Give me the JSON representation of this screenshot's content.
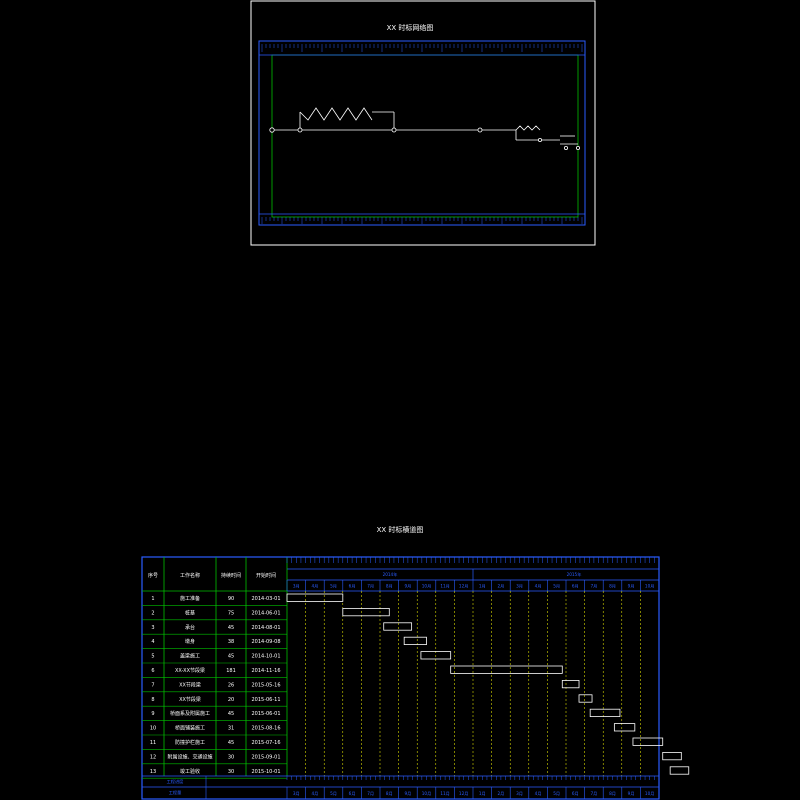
{
  "sheet1": {
    "title": "XX 时标网络图"
  },
  "sheet2": {
    "title": "XX 时标横道图",
    "headers": {
      "no": "序号",
      "task": "工作名称",
      "duration": "持续时间",
      "start": "开始时间"
    },
    "year_labels": [
      "2014年",
      "2015年"
    ],
    "months": [
      "3月",
      "4月",
      "5月",
      "6月",
      "7月",
      "8月",
      "9月",
      "10月",
      "11月",
      "12月",
      "1月",
      "2月",
      "3月",
      "4月",
      "5月",
      "6月",
      "7月",
      "8月",
      "9月",
      "10月"
    ],
    "footer": {
      "row1": "工程进度",
      "row2": "工程量"
    },
    "tasks": [
      {
        "no": "1",
        "name": "施工准备",
        "duration": "90",
        "start": "2014-03-01",
        "bar_start_month": 0,
        "bar_months": 3
      },
      {
        "no": "2",
        "name": "桩基",
        "duration": "75",
        "start": "2014-06-01",
        "bar_start_month": 3,
        "bar_months": 2.5
      },
      {
        "no": "3",
        "name": "承台",
        "duration": "45",
        "start": "2014-08-01",
        "bar_start_month": 5.2,
        "bar_months": 1.5
      },
      {
        "no": "4",
        "name": "墩身",
        "duration": "38",
        "start": "2014-09-08",
        "bar_start_month": 6.3,
        "bar_months": 1.2
      },
      {
        "no": "5",
        "name": "盖梁施工",
        "duration": "45",
        "start": "2014-10-01",
        "bar_start_month": 7.2,
        "bar_months": 1.6
      },
      {
        "no": "6",
        "name": "XX-XX节段梁",
        "duration": "181",
        "start": "2014-11-16",
        "bar_start_month": 8.8,
        "bar_months": 6
      },
      {
        "no": "7",
        "name": "XX节段梁",
        "duration": "26",
        "start": "2015-05-16",
        "bar_start_month": 14.8,
        "bar_months": 0.9
      },
      {
        "no": "8",
        "name": "XX节段梁",
        "duration": "20",
        "start": "2015-06-11",
        "bar_start_month": 15.7,
        "bar_months": 0.7
      },
      {
        "no": "9",
        "name": "桥面系及附属施工",
        "duration": "45",
        "start": "2015-06-01",
        "bar_start_month": 16.3,
        "bar_months": 1.6
      },
      {
        "no": "10",
        "name": "桥面铺装施工",
        "duration": "31",
        "start": "2015-08-16",
        "bar_start_month": 17.6,
        "bar_months": 1.1
      },
      {
        "no": "11",
        "name": "防撞护栏施工",
        "duration": "45",
        "start": "2015-07-16",
        "bar_start_month": 18.6,
        "bar_months": 1.6
      },
      {
        "no": "12",
        "name": "附属设施、交通设施",
        "duration": "30",
        "start": "2015-09-01",
        "bar_start_month": 20.2,
        "bar_months": 1.0
      },
      {
        "no": "13",
        "name": "竣工验收",
        "duration": "30",
        "start": "2015-10-01",
        "bar_start_month": 20.6,
        "bar_months": 1.0
      }
    ]
  },
  "colors": {
    "background": "#000000",
    "frame": "#ffffff",
    "border_blue": "#2a5cff",
    "inner_green": "#00c000",
    "dash_yellow": "#ffff00",
    "bar": "#ffffff"
  }
}
